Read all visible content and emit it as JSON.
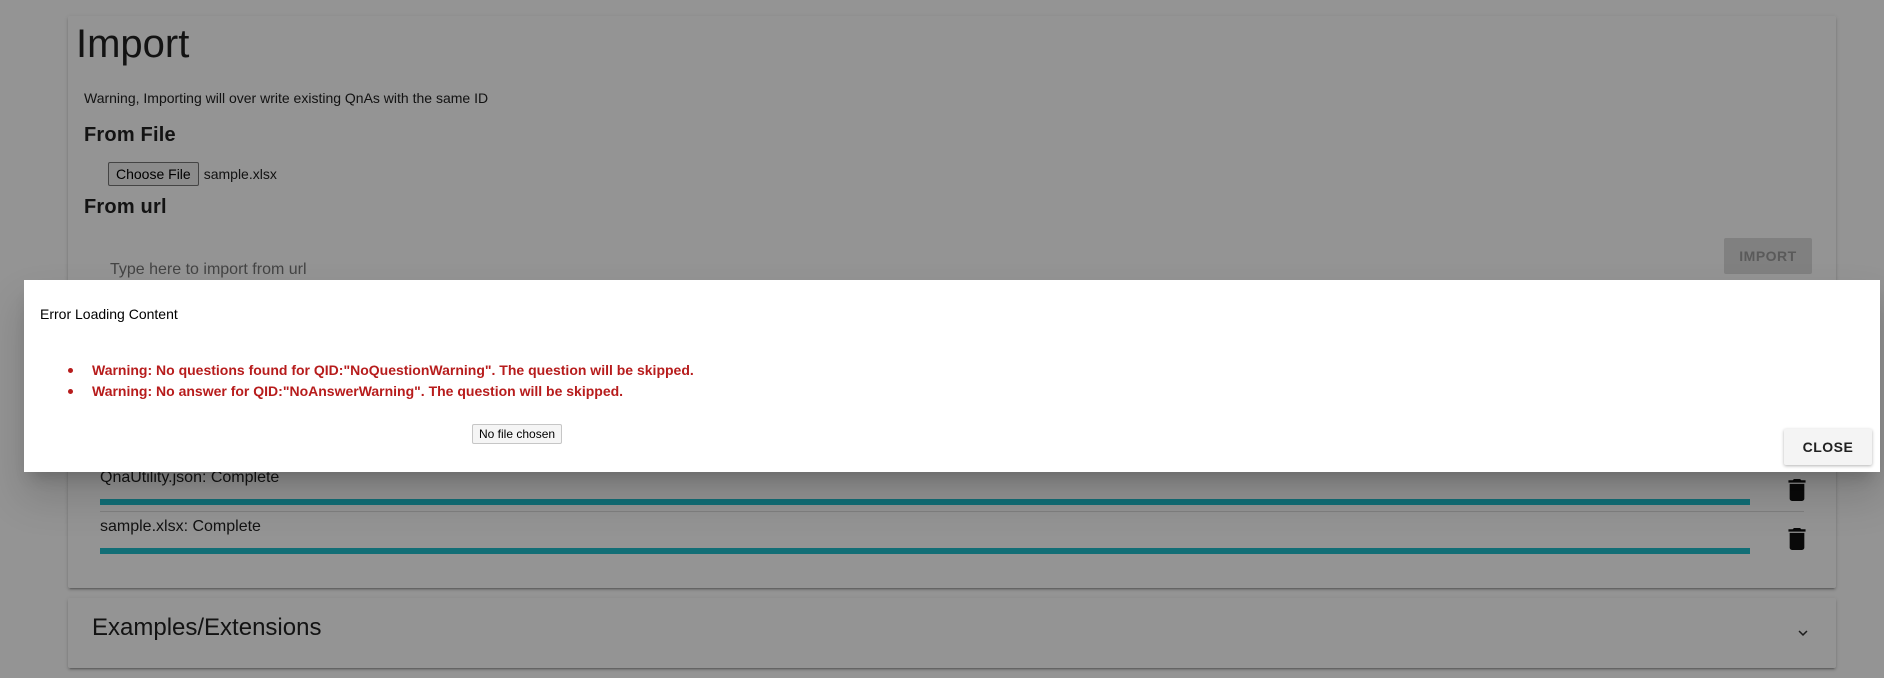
{
  "import": {
    "title": "Import",
    "warning": "Warning, Importing will over write existing QnAs with the same ID",
    "from_file_title": "From File",
    "choose_file_label": "Choose File",
    "selected_file": "sample.xlsx",
    "from_url_title": "From url",
    "url_placeholder": "Type here to import from url",
    "url_value": "",
    "import_button": "IMPORT"
  },
  "jobs": [
    {
      "label": "QnaUtility.json: Complete",
      "progress": 1.0,
      "icon": "trash-icon"
    },
    {
      "label": "sample.xlsx: Complete",
      "progress": 1.0,
      "icon": "trash-icon"
    }
  ],
  "examples": {
    "title": "Examples/Extensions",
    "icon": "chevron-down-icon"
  },
  "dialog": {
    "title": "Error Loading Content",
    "errors": [
      "Warning: No questions found for QID:\"NoQuestionWarning\". The question will be skipped.",
      "Warning: No answer for QID:\"NoAnswerWarning\". The question will be skipped."
    ],
    "file_status": "No file chosen",
    "close_button": "CLOSE"
  },
  "colors": {
    "progress": "#1fbecc",
    "error_text": "#b71c1c",
    "overlay": "rgba(0,0,0,0.42)"
  }
}
